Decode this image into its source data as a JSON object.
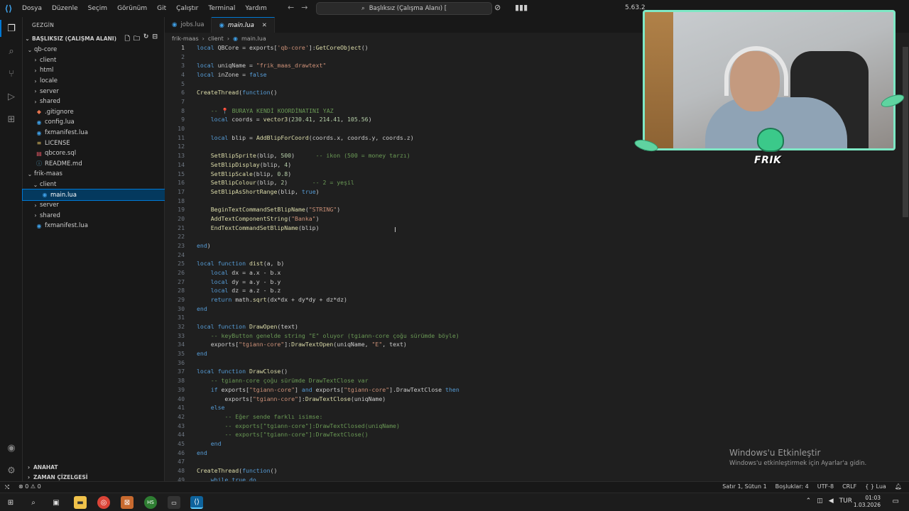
{
  "titlebar": {
    "menu": [
      "Dosya",
      "Düzenle",
      "Seçim",
      "Görünüm",
      "Git",
      "Çalıştır",
      "Terminal",
      "Yardım"
    ],
    "command_center": "Başlıksız (Çalışma Alanı) [",
    "version": "5.63.2"
  },
  "sidebar": {
    "title": "GEZGİN",
    "workspace": "BAŞLIKSIZ (ÇALIŞMA ALANI)",
    "tree": [
      {
        "label": "qb-core",
        "depth": 1,
        "type": "folder",
        "open": true
      },
      {
        "label": "client",
        "depth": 2,
        "type": "folder",
        "open": false
      },
      {
        "label": "html",
        "depth": 2,
        "type": "folder",
        "open": false
      },
      {
        "label": "locale",
        "depth": 2,
        "type": "folder",
        "open": false
      },
      {
        "label": "server",
        "depth": 2,
        "type": "folder",
        "open": false
      },
      {
        "label": "shared",
        "depth": 2,
        "type": "folder",
        "open": false
      },
      {
        "label": ".gitignore",
        "depth": 2,
        "type": "file",
        "icon": "git"
      },
      {
        "label": "config.lua",
        "depth": 2,
        "type": "file",
        "icon": "lua"
      },
      {
        "label": "fxmanifest.lua",
        "depth": 2,
        "type": "file",
        "icon": "lua"
      },
      {
        "label": "LICENSE",
        "depth": 2,
        "type": "file",
        "icon": "license"
      },
      {
        "label": "qbcore.sql",
        "depth": 2,
        "type": "file",
        "icon": "sql"
      },
      {
        "label": "README.md",
        "depth": 2,
        "type": "file",
        "icon": "md"
      },
      {
        "label": "frik-maas",
        "depth": 1,
        "type": "folder",
        "open": true
      },
      {
        "label": "client",
        "depth": 2,
        "type": "folder",
        "open": true
      },
      {
        "label": "main.lua",
        "depth": 3,
        "type": "file",
        "icon": "lua",
        "selected": true
      },
      {
        "label": "server",
        "depth": 2,
        "type": "folder",
        "open": false
      },
      {
        "label": "shared",
        "depth": 2,
        "type": "folder",
        "open": false
      },
      {
        "label": "fxmanifest.lua",
        "depth": 2,
        "type": "file",
        "icon": "lua"
      }
    ],
    "sections": [
      "ANAHAT",
      "ZAMAN ÇİZELGESİ"
    ]
  },
  "editor": {
    "tabs": [
      {
        "label": "jobs.lua",
        "active": false
      },
      {
        "label": "main.lua",
        "active": true
      }
    ],
    "breadcrumbs": [
      "frik-maas",
      "client",
      "main.lua"
    ],
    "lines": [
      "local QBCore = exports['qb-core']:GetCoreObject()",
      "",
      "local uniqName = \"frik_maas_drawtext\"",
      "local inZone = false",
      "",
      "CreateThread(function()",
      "",
      "    -- 📍 BURAYA KENDİ KOORDİNATINI YAZ",
      "    local coords = vector3(230.41, 214.41, 105.56)",
      "",
      "    local blip = AddBlipForCoord(coords.x, coords.y, coords.z)",
      "",
      "    SetBlipSprite(blip, 500)      -- ikon (500 = money tarzı)",
      "    SetBlipDisplay(blip, 4)",
      "    SetBlipScale(blip, 0.8)",
      "    SetBlipColour(blip, 2)       -- 2 = yeşil",
      "    SetBlipAsShortRange(blip, true)",
      "",
      "    BeginTextCommandSetBlipName(\"STRING\")",
      "    AddTextComponentString(\"Banka\")",
      "    EndTextCommandSetBlipName(blip)",
      "",
      "end)",
      "",
      "local function dist(a, b)",
      "    local dx = a.x - b.x",
      "    local dy = a.y - b.y",
      "    local dz = a.z - b.z",
      "    return math.sqrt(dx*dx + dy*dy + dz*dz)",
      "end",
      "",
      "local function DrawOpen(text)",
      "    -- keyButton genelde string \"E\" oluyor (tgiann-core çoğu sürümde böyle)",
      "    exports[\"tgiann-core\"]:DrawTextOpen(uniqName, \"E\", text)",
      "end",
      "",
      "local function DrawClose()",
      "    -- tgiann-core çoğu sürümde DrawTextClose var",
      "    if exports[\"tgiann-core\"] and exports[\"tgiann-core\"].DrawTextClose then",
      "        exports[\"tgiann-core\"]:DrawTextClose(uniqName)",
      "    else",
      "        -- Eğer sende farklı isimse:",
      "        -- exports[\"tgiann-core\"]:DrawTextClosed(uniqName)",
      "        -- exports[\"tgiann-core\"]:DrawTextClose()",
      "    end",
      "end",
      "",
      "CreateThread(function()",
      "    while true do"
    ]
  },
  "overlay": {
    "brand": "FRIK",
    "watermark_title": "Windows'u Etkinleştir",
    "watermark_sub": "Windows'u etkinleştirmek için Ayarlar'a gidin."
  },
  "statusbar": {
    "problems": "⊗ 0 ⚠ 0",
    "items": [
      "Satır 1, Sütun 1",
      "Boşluklar: 4",
      "UTF-8",
      "CRLF",
      "{ } Lua"
    ]
  },
  "taskbar": {
    "lang": "TUR",
    "time": "01:03",
    "date": "1.03.2026"
  },
  "colors": {
    "accent": "#0078d4",
    "selection": "#04395e",
    "keyword": "#569cd6",
    "string": "#ce9178",
    "comment": "#6a9955",
    "function": "#dcdcaa"
  }
}
